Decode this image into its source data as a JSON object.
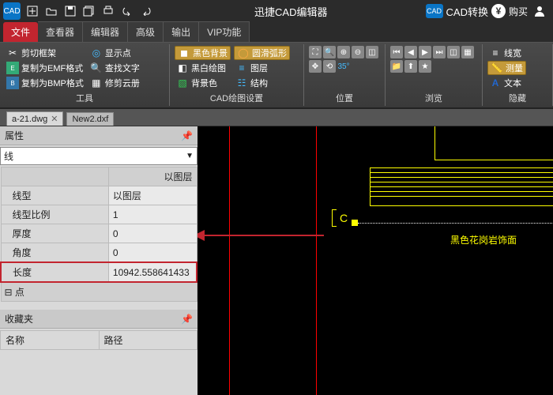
{
  "app": {
    "title": "迅捷CAD编辑器"
  },
  "titlebar_right": {
    "conv_label": "CAD",
    "conv_text": "CAD转换",
    "buy": "购买"
  },
  "menu": {
    "tabs": [
      "文件",
      "查看器",
      "编辑器",
      "高级",
      "输出",
      "VIP功能"
    ],
    "active": 0
  },
  "ribbon": {
    "tools": {
      "label": "工具",
      "items": {
        "clip_frame": "剪切框架",
        "copy_emf": "复制为EMF格式",
        "copy_bmp": "复制为BMP格式",
        "show_point": "显示点",
        "find_text": "查找文字",
        "trim_album": "修剪云册"
      }
    },
    "drawset": {
      "label": "CAD绘图设置",
      "items": {
        "black_bg": "黑色背景",
        "smooth_arc": "圆滑弧形",
        "bw": "黑白绘图",
        "layer": "图层",
        "bg_color": "背景色",
        "struct": "结构"
      }
    },
    "position": {
      "label": "位置"
    },
    "browse": {
      "label": "浏览"
    },
    "hide": {
      "label": "隐藏",
      "items": {
        "linew": "线宽",
        "measure": "测量",
        "text": "文本"
      }
    }
  },
  "doctabs": [
    "a-21.dwg",
    "New2.dxf"
  ],
  "properties": {
    "title": "属性",
    "entity_type": "线",
    "headers_row": "以图层",
    "rows": {
      "linetype": {
        "label": "线型",
        "value": "以图层"
      },
      "lts": {
        "label": "线型比例",
        "value": "1"
      },
      "thickness": {
        "label": "厚度",
        "value": "0"
      },
      "angle": {
        "label": "角度",
        "value": "0"
      },
      "length": {
        "label": "长度",
        "value": "10942.558641433"
      },
      "point": {
        "label": "点",
        "value": ""
      }
    }
  },
  "favorites": {
    "title": "收藏夹",
    "col_name": "名称",
    "col_path": "路径"
  },
  "canvas": {
    "c_label": "C",
    "anno": "黑色花岗岩饰面"
  }
}
